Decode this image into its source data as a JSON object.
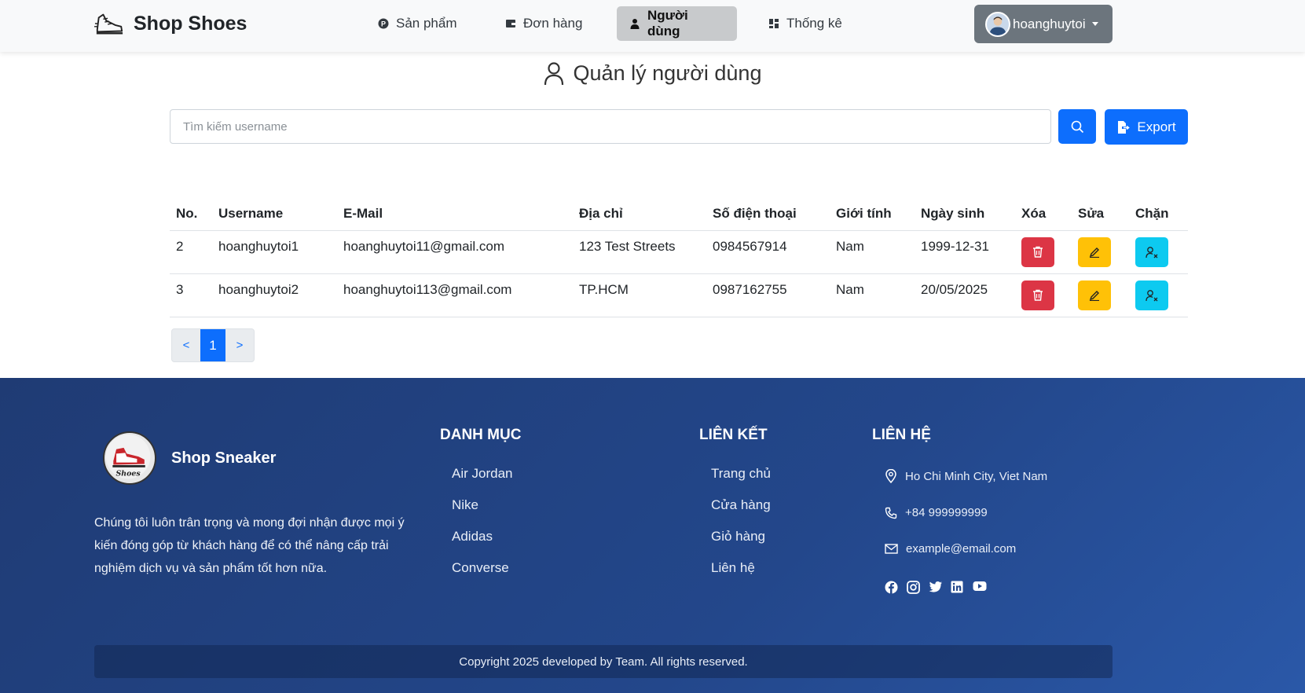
{
  "nav": {
    "brand": "Shop Shoes",
    "items": [
      {
        "label": "Sản phẩm",
        "icon": "product-icon"
      },
      {
        "label": "Đơn hàng",
        "icon": "wallet-icon"
      },
      {
        "label": "Người dùng",
        "icon": "user-icon",
        "active": true
      },
      {
        "label": "Thống kê",
        "icon": "dashboard-icon"
      }
    ],
    "user": "hoanghuytoi"
  },
  "page": {
    "title": "Quản lý người dùng",
    "search_placeholder": "Tìm kiếm username",
    "export_label": "Export"
  },
  "table": {
    "headers": [
      "No.",
      "Username",
      "E-Mail",
      "Địa chỉ",
      "Số điện thoại",
      "Giới tính",
      "Ngày sinh",
      "Xóa",
      "Sửa",
      "Chặn"
    ],
    "rows": [
      {
        "no": "2",
        "username": "hoanghuytoi1",
        "email": "hoanghuytoi11@gmail.com",
        "address": "123 Test Streets",
        "phone": "0984567914",
        "gender": "Nam",
        "dob": "1999-12-31"
      },
      {
        "no": "3",
        "username": "hoanghuytoi2",
        "email": "hoanghuytoi113@gmail.com",
        "address": "TP.HCM",
        "phone": "0987162755",
        "gender": "Nam",
        "dob": "20/05/2025"
      }
    ]
  },
  "pagination": {
    "prev": "<",
    "current": "1",
    "next": ">"
  },
  "footer": {
    "brand": "Shop Sneaker",
    "description": "Chúng tôi luôn trân trọng và mong đợi nhận được mọi ý kiến đóng góp từ khách hàng để có thể nâng cấp trải nghiệm dịch vụ và sản phẩm tốt hơn nữa.",
    "categories_title": "DANH MỤC",
    "categories": [
      "Air Jordan",
      "Nike",
      "Adidas",
      "Converse"
    ],
    "links_title": "LIÊN KẾT",
    "links": [
      "Trang chủ",
      "Cửa hàng",
      "Giỏ hàng",
      "Liên hệ"
    ],
    "contact_title": "LIÊN HỆ",
    "address": "Ho Chi Minh City, Viet Nam",
    "phone": "+84 999999999",
    "email": "example@email.com",
    "social": [
      "facebook-icon",
      "instagram-icon",
      "twitter-icon",
      "linkedin-icon",
      "youtube-icon"
    ],
    "copyright": "Copyright 2025 developed by Team. All rights reserved."
  },
  "colors": {
    "primary": "#0d6efd",
    "danger": "#dc3545",
    "warning": "#ffc107",
    "info": "#0dcaf0",
    "footer_bg": "#23478b"
  }
}
